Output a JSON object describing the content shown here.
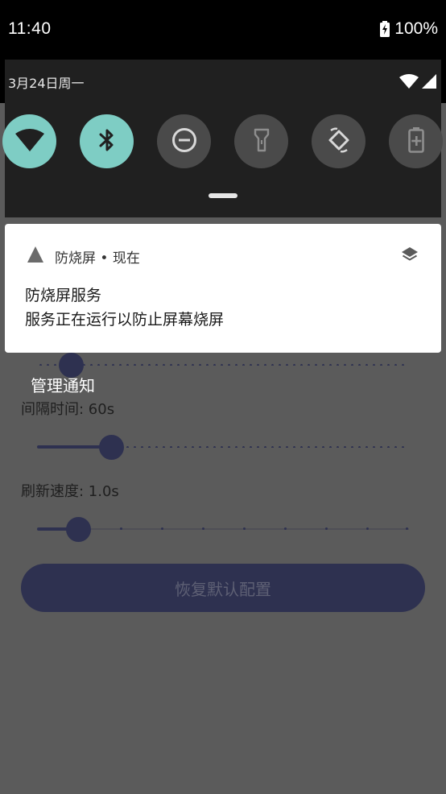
{
  "status_bar": {
    "time": "11:40",
    "battery_percent": "100%"
  },
  "quick_settings": {
    "date": "3月24日周一",
    "tiles": [
      {
        "icon": "wifi-icon",
        "on": true
      },
      {
        "icon": "bluetooth-icon",
        "on": true
      },
      {
        "icon": "do-not-disturb-icon",
        "on": false
      },
      {
        "icon": "flashlight-icon",
        "on": false
      },
      {
        "icon": "auto-rotate-icon",
        "on": false
      },
      {
        "icon": "battery-saver-icon",
        "on": false
      }
    ]
  },
  "notification": {
    "app_name": "防烧屏 • 现在",
    "title": "防烧屏服务",
    "body": "服务正在运行以防止屏幕烧屏"
  },
  "app": {
    "manage_label": "管理通知",
    "sliders": {
      "top_level": 0.09,
      "interval_level": 0.2,
      "refresh_level": 0.11
    },
    "interval_label": "间隔时间: 60s",
    "refresh_label": "刷新速度: 1.0s",
    "reset_button": "恢复默认配置"
  },
  "colors": {
    "accent": "#2e3150",
    "tile_on": "#7ecdc4",
    "tile_off": "#4a4a4a",
    "panel": "#202020"
  }
}
